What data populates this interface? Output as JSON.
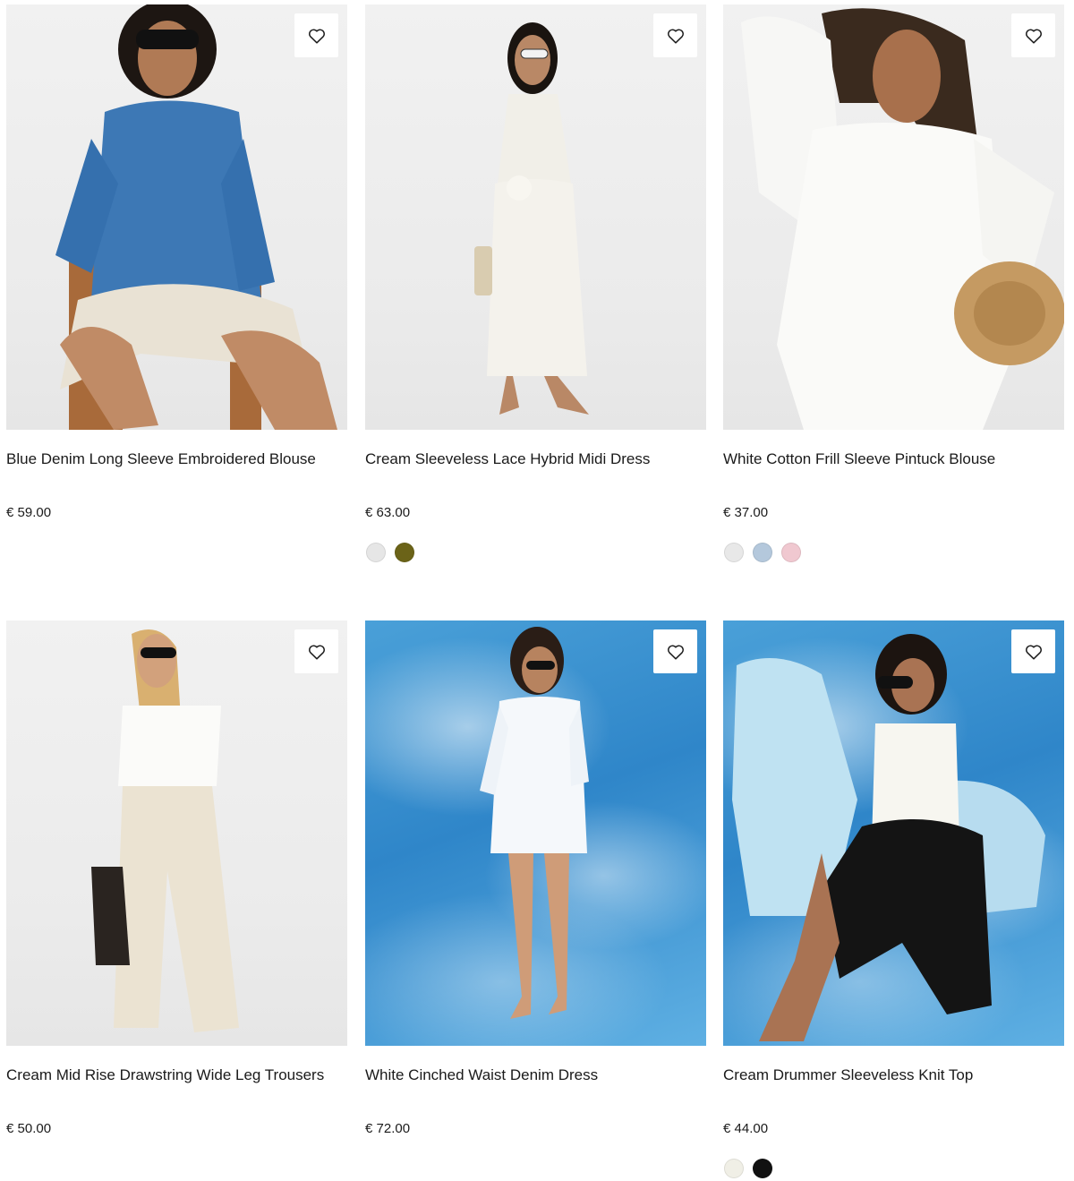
{
  "products": [
    {
      "name": "Blue Denim Long Sleeve Embroidered Blouse",
      "price": "€ 59.00",
      "image": "model-blue-denim-blouse-photo",
      "swatches": []
    },
    {
      "name": "Cream Sleeveless Lace Hybrid Midi Dress",
      "price": "€ 63.00",
      "image": "model-cream-midi-dress-photo",
      "swatches": [
        "#e6e6e6",
        "#6b6318"
      ]
    },
    {
      "name": "White Cotton Frill Sleeve Pintuck Blouse",
      "price": "€ 37.00",
      "image": "model-white-pintuck-blouse-photo",
      "swatches": [
        "#e8e8e8",
        "#b4c8dc",
        "#f0c8d0"
      ]
    },
    {
      "name": "Cream Mid Rise Drawstring Wide Leg Trousers",
      "price": "€ 50.00",
      "image": "model-cream-wide-leg-trousers-photo",
      "swatches": []
    },
    {
      "name": "White Cinched Waist Denim Dress",
      "price": "€ 72.00",
      "image": "model-white-denim-dress-photo",
      "swatches": []
    },
    {
      "name": "Cream Drummer Sleeveless Knit Top",
      "price": "€ 44.00",
      "image": "model-cream-knit-top-photo",
      "swatches": [
        "#f0efe6",
        "#111111"
      ]
    }
  ],
  "icons": {
    "wishlist": "heart-outline-icon"
  }
}
